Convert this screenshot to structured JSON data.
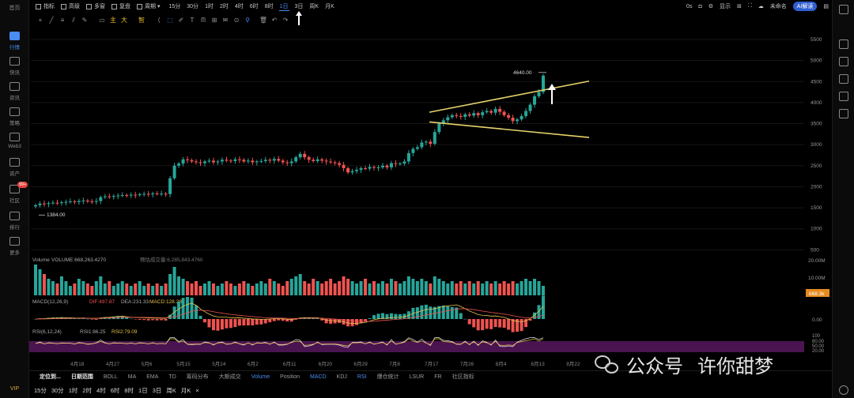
{
  "left_nav": {
    "home": "首页",
    "items": [
      {
        "label": "行情",
        "icon": "chart-icon",
        "active": true
      },
      {
        "label": "快讯",
        "icon": "news-flash-icon"
      },
      {
        "label": "资讯",
        "icon": "article-icon"
      },
      {
        "label": "策略",
        "icon": "strategy-icon"
      },
      {
        "label": "Web3",
        "icon": "web3-icon"
      },
      {
        "label": "资产",
        "icon": "wallet-icon"
      },
      {
        "label": "社区",
        "icon": "community-icon",
        "badge": "99+"
      },
      {
        "label": "排行",
        "icon": "ranking-icon"
      },
      {
        "label": "更多",
        "icon": "grid-icon"
      }
    ],
    "vip": "VIP"
  },
  "toolbar": {
    "indicators": "指标",
    "advanced": "高级",
    "multi_chart": "多窗",
    "replay": "复盘",
    "period": "周期",
    "timeframes": [
      "15分",
      "30分",
      "1时",
      "2时",
      "4时",
      "6时",
      "8时",
      "1日",
      "3日",
      "周K",
      "月K"
    ],
    "active_timeframe": "1日"
  },
  "top_right": {
    "seconds": "0s",
    "display": "显示",
    "unnamed": "未命名",
    "ai": "AI解读"
  },
  "draw_tools": [
    {
      "icon": "crosshair-icon",
      "glyph": "+",
      "cls": ""
    },
    {
      "icon": "line-icon",
      "glyph": "╱",
      "cls": ""
    },
    {
      "icon": "horizontal-lines-icon",
      "glyph": "≡",
      "cls": ""
    },
    {
      "icon": "channel-icon",
      "glyph": "⫽",
      "cls": ""
    },
    {
      "icon": "pen-icon",
      "glyph": "✎",
      "cls": ""
    },
    {
      "icon": "ruler-icon",
      "glyph": "▭",
      "cls": ""
    },
    {
      "icon": "main-force-icon",
      "glyph": "主",
      "cls": "y"
    },
    {
      "icon": "big-order-icon",
      "glyph": "大",
      "cls": "y"
    },
    {
      "icon": "smart-icon",
      "glyph": "智",
      "cls": "y"
    },
    {
      "icon": "bracket-icon",
      "glyph": "⟨",
      "cls": ""
    },
    {
      "icon": "select-icon",
      "glyph": "⬚",
      "cls": "b"
    },
    {
      "icon": "brush-icon",
      "glyph": "✐",
      "cls": ""
    },
    {
      "icon": "text-icon",
      "glyph": "T",
      "cls": ""
    },
    {
      "icon": "pattern-icon",
      "glyph": "ᗰ",
      "cls": ""
    },
    {
      "icon": "measure-icon",
      "glyph": "⊞",
      "cls": ""
    },
    {
      "icon": "note-icon",
      "glyph": "✉",
      "cls": ""
    },
    {
      "icon": "magnet-icon",
      "glyph": "⊙",
      "cls": ""
    },
    {
      "icon": "filter-icon",
      "glyph": "⚲",
      "cls": "b"
    },
    {
      "icon": "trash-icon",
      "glyph": "🗑",
      "cls": ""
    },
    {
      "icon": "undo-icon",
      "glyph": "↶",
      "cls": ""
    },
    {
      "icon": "redo-icon",
      "glyph": "↷",
      "cls": ""
    }
  ],
  "indicator_bar": {
    "items": [
      "定位到...",
      "日期范围",
      "BOLL",
      "MA",
      "EMA",
      "TD",
      "筹码分布",
      "大额成交",
      "Volume",
      "Position",
      "MACD",
      "KDJ",
      "RSI",
      "爆仓统计",
      "LSUR",
      "FR",
      "社区指标"
    ],
    "active": [
      "Volume",
      "MACD",
      "RSI"
    ],
    "strong": [
      "定位到...",
      "日期范围"
    ]
  },
  "timeframe_bar": [
    "15分",
    "30分",
    "1时",
    "2时",
    "4时",
    "6时",
    "8时",
    "1日",
    "3日",
    "周K",
    "月K",
    "×"
  ],
  "colors": {
    "up": "#26a69a",
    "down": "#ef5350",
    "trendline": "#e6d36a",
    "accent": "#4a8cf2",
    "macd_line": "#e5c14a",
    "signal_line": "#ef5350",
    "rsi_line": "#e5c14a",
    "rsi_band": "#6b1f6e"
  },
  "chart_data": {
    "type": "candlestick",
    "price_axis": {
      "ticks": [
        5500,
        5000,
        4500,
        4000,
        3500,
        3000,
        2500,
        2000,
        1500,
        1000,
        500
      ],
      "ylim": [
        450,
        5650
      ]
    },
    "date_axis": [
      "4月18",
      "4月27",
      "5月6",
      "5月15",
      "5月24",
      "6月2",
      "6月11",
      "6月20",
      "6月29",
      "7月8",
      "7月17",
      "7月26",
      "8月4",
      "8月13",
      "8月22"
    ],
    "annotations": {
      "high": "4640.00",
      "low": "1384.00"
    },
    "closes": [
      1560,
      1600,
      1590,
      1610,
      1620,
      1615,
      1630,
      1640,
      1650,
      1635,
      1660,
      1670,
      1650,
      1640,
      1660,
      1750,
      1770,
      1760,
      1780,
      1790,
      1800,
      1795,
      1810,
      1800,
      1820,
      1830,
      1820,
      1840,
      1830,
      1835,
      1825,
      2200,
      2500,
      2550,
      2650,
      2630,
      2600,
      2580,
      2560,
      2600,
      2620,
      2580,
      2600,
      2640,
      2620,
      2610,
      2650,
      2640,
      2600,
      2620,
      2580,
      2600,
      2610,
      2640,
      2620,
      2660,
      2620,
      2580,
      2560,
      2600,
      2700,
      2780,
      2700,
      2640,
      2610,
      2650,
      2620,
      2600,
      2580,
      2560,
      2520,
      2440,
      2340,
      2370,
      2400,
      2440,
      2430,
      2470,
      2450,
      2460,
      2500,
      2460,
      2560,
      2540,
      2550,
      2600,
      2800,
      2900,
      2940,
      3050,
      3070,
      3020,
      3300,
      3500,
      3580,
      3650,
      3700,
      3680,
      3660,
      3720,
      3690,
      3750,
      3700,
      3770,
      3800,
      3760,
      3850,
      3780,
      3700,
      3640,
      3560,
      3600,
      3680,
      3800,
      3950,
      4150,
      4250,
      4640
    ],
    "volume": {
      "label": "Volume",
      "value": "VOLUME:668,263.4270",
      "extra": "预估成交量:6,285,843.4760",
      "ticks": [
        "20.00M",
        "10.00M"
      ],
      "last": "668.3k",
      "values": [
        1.3,
        1.1,
        0.9,
        0.7,
        0.6,
        0.5,
        0.8,
        0.6,
        0.4,
        0.5,
        0.7,
        0.6,
        0.5,
        0.4,
        0.6,
        0.8,
        0.5,
        0.6,
        0.4,
        0.5,
        0.6,
        0.5,
        0.4,
        0.5,
        0.6,
        0.4,
        0.5,
        0.4,
        0.5,
        0.4,
        0.5,
        0.9,
        1.2,
        0.8,
        0.7,
        0.6,
        0.5,
        0.6,
        0.4,
        0.5,
        0.6,
        0.5,
        0.4,
        0.5,
        0.6,
        0.5,
        0.4,
        0.5,
        0.6,
        0.5,
        0.4,
        0.5,
        0.6,
        0.5,
        0.7,
        0.6,
        0.5,
        0.4,
        0.6,
        0.7,
        0.8,
        0.9,
        0.6,
        0.5,
        0.7,
        0.6,
        0.5,
        0.6,
        0.7,
        0.5,
        0.6,
        0.8,
        0.7,
        0.6,
        0.5,
        0.6,
        0.7,
        0.5,
        0.6,
        0.5,
        0.6,
        0.5,
        0.7,
        0.6,
        0.5,
        0.6,
        0.8,
        0.7,
        0.6,
        0.7,
        0.6,
        0.5,
        0.8,
        0.7,
        0.6,
        0.5,
        0.6,
        0.5,
        0.6,
        0.5,
        0.6,
        0.5,
        0.6,
        0.5,
        0.6,
        0.5,
        0.6,
        0.5,
        0.6,
        0.5,
        0.6,
        0.5,
        0.6,
        0.7,
        0.6,
        0.7,
        0.6,
        0.4
      ]
    },
    "macd": {
      "label": "MACD(12,26,9)",
      "dif": "DIF:497.87",
      "dea": "DEA:231.33",
      "value": "MACD:128.28",
      "ticks": [
        "0.00"
      ]
    },
    "rsi": {
      "label": "RSI(6,12,24)",
      "rsi1": "RSI1:86.25",
      "rsi2": "RSI2:79.09",
      "ticks": [
        "100",
        "80.00",
        "50.00",
        "20.00"
      ]
    }
  }
}
